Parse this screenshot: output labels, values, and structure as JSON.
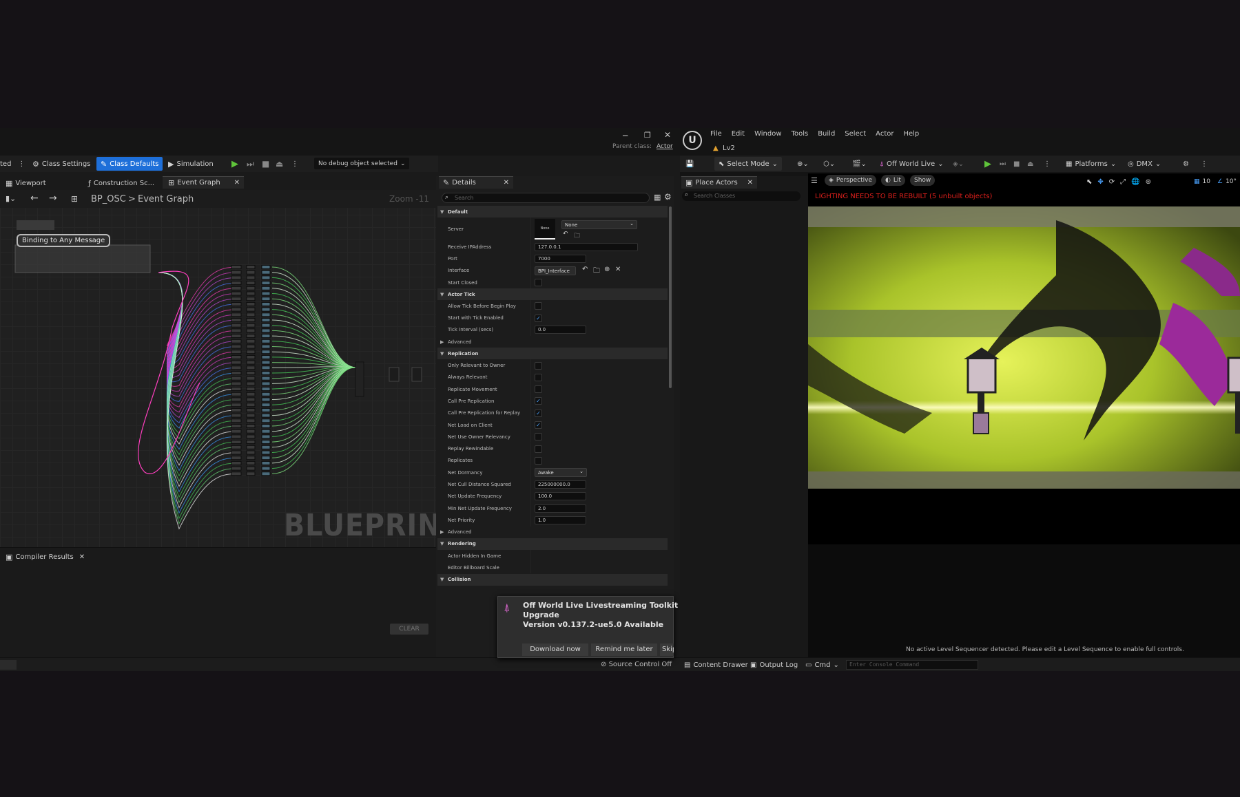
{
  "left_editor": {
    "title_bar": {
      "parent_class_label": "Parent class:",
      "parent_class_value": "Actor",
      "minimize": "─",
      "restore": "❐",
      "close": "✕"
    },
    "toolbar": {
      "cut_text": "ted",
      "class_settings": "Class Settings",
      "class_defaults": "Class Defaults",
      "simulation": "Simulation",
      "debug_select": "No debug object selected"
    },
    "tabs": [
      {
        "label": "Viewport"
      },
      {
        "label": "Construction Sc..."
      },
      {
        "label": "Event Graph"
      }
    ],
    "breadcrumb": {
      "root": "BP_OSC",
      "sep": ">",
      "leaf": "Event Graph",
      "zoom": "Zoom -11"
    },
    "graph": {
      "node_label": "Binding to Any Message",
      "watermark": "BLUEPRINT"
    },
    "compiler": {
      "tab": "Compiler Results",
      "clear": "CLEAR"
    },
    "source_control": "Source Control Off"
  },
  "details": {
    "tab": "Details",
    "search_placeholder": "Search",
    "rows": [
      {
        "type": "hdr",
        "label": "Default"
      },
      {
        "type": "server",
        "label": "Server",
        "thumb": "None",
        "value": "None"
      },
      {
        "type": "field",
        "label": "Receive IPAddress",
        "value": "127.0.0.1",
        "w": 220
      },
      {
        "type": "field",
        "label": "Port",
        "value": "7000",
        "w": 110
      },
      {
        "type": "iface",
        "label": "Interface",
        "value": "BPI_Interface"
      },
      {
        "type": "check",
        "label": "Start Closed",
        "checked": false
      },
      {
        "type": "hdr",
        "label": "Actor Tick"
      },
      {
        "type": "check",
        "label": "Allow Tick Before Begin Play",
        "checked": false
      },
      {
        "type": "check",
        "label": "Start with Tick Enabled",
        "checked": true
      },
      {
        "type": "field",
        "label": "Tick Interval (secs)",
        "value": "0.0",
        "w": 110
      },
      {
        "type": "sub",
        "label": "Advanced"
      },
      {
        "type": "hdr",
        "label": "Replication"
      },
      {
        "type": "check",
        "label": "Only Relevant to Owner",
        "checked": false
      },
      {
        "type": "check",
        "label": "Always Relevant",
        "checked": false
      },
      {
        "type": "check",
        "label": "Replicate Movement",
        "checked": false
      },
      {
        "type": "check",
        "label": "Call Pre Replication",
        "checked": true
      },
      {
        "type": "check",
        "label": "Call Pre Replication for Replay",
        "checked": true
      },
      {
        "type": "check",
        "label": "Net Load on Client",
        "checked": true
      },
      {
        "type": "check",
        "label": "Net Use Owner Relevancy",
        "checked": false
      },
      {
        "type": "check",
        "label": "Replay Rewindable",
        "checked": false
      },
      {
        "type": "check",
        "label": "Replicates",
        "checked": false
      },
      {
        "type": "dd",
        "label": "Net Dormancy",
        "value": "Awake"
      },
      {
        "type": "field",
        "label": "Net Cull Distance Squared",
        "value": "225000000.0",
        "w": 110
      },
      {
        "type": "field",
        "label": "Net Update Frequency",
        "value": "100.0",
        "w": 110
      },
      {
        "type": "field",
        "label": "Min Net Update Frequency",
        "value": "2.0",
        "w": 110
      },
      {
        "type": "field",
        "label": "Net Priority",
        "value": "1.0",
        "w": 110
      },
      {
        "type": "sub",
        "label": "Advanced"
      },
      {
        "type": "hdr",
        "label": "Rendering"
      },
      {
        "type": "plain",
        "label": "Actor Hidden In Game"
      },
      {
        "type": "plain",
        "label": "Editor Billboard Scale"
      },
      {
        "type": "hdr",
        "label": "Collision"
      }
    ]
  },
  "notification": {
    "title": "Off World Live Livestreaming Toolkit",
    "line2": "Upgrade",
    "line3": "Version v0.137.2-ue5.0 Available",
    "btn_download": "Download now",
    "btn_remind": "Remind me later",
    "btn_skip": "Skip"
  },
  "right_editor": {
    "menu": [
      "File",
      "Edit",
      "Window",
      "Tools",
      "Build",
      "Select",
      "Actor",
      "Help"
    ],
    "level_tab": "Lv2",
    "toolbar": {
      "select_mode": "Select Mode",
      "off_world_live": "Off World Live",
      "platforms": "Platforms",
      "dmx": "DMX"
    },
    "place_actors": {
      "tab": "Place Actors",
      "search_placeholder": "Search Classes"
    },
    "viewport": {
      "perspective": "Perspective",
      "lit": "Lit",
      "show": "Show",
      "grid_value": "10",
      "angle_value": "10°",
      "warning": "LIGHTING NEEDS TO BE REBUILT (5 unbuilt objects)",
      "sequencer_msg": "No active Level Sequencer detected. Please edit a Level Sequence to enable full controls."
    },
    "bottom_bar": {
      "content_drawer": "Content Drawer",
      "output_log": "Output Log",
      "cmd": "Cmd",
      "console_placeholder": "Enter Console Command"
    }
  },
  "colors": {
    "accent": "#1e6fd9",
    "warning": "#e0201c",
    "bg": "#151216",
    "play": "#5fc43a"
  }
}
